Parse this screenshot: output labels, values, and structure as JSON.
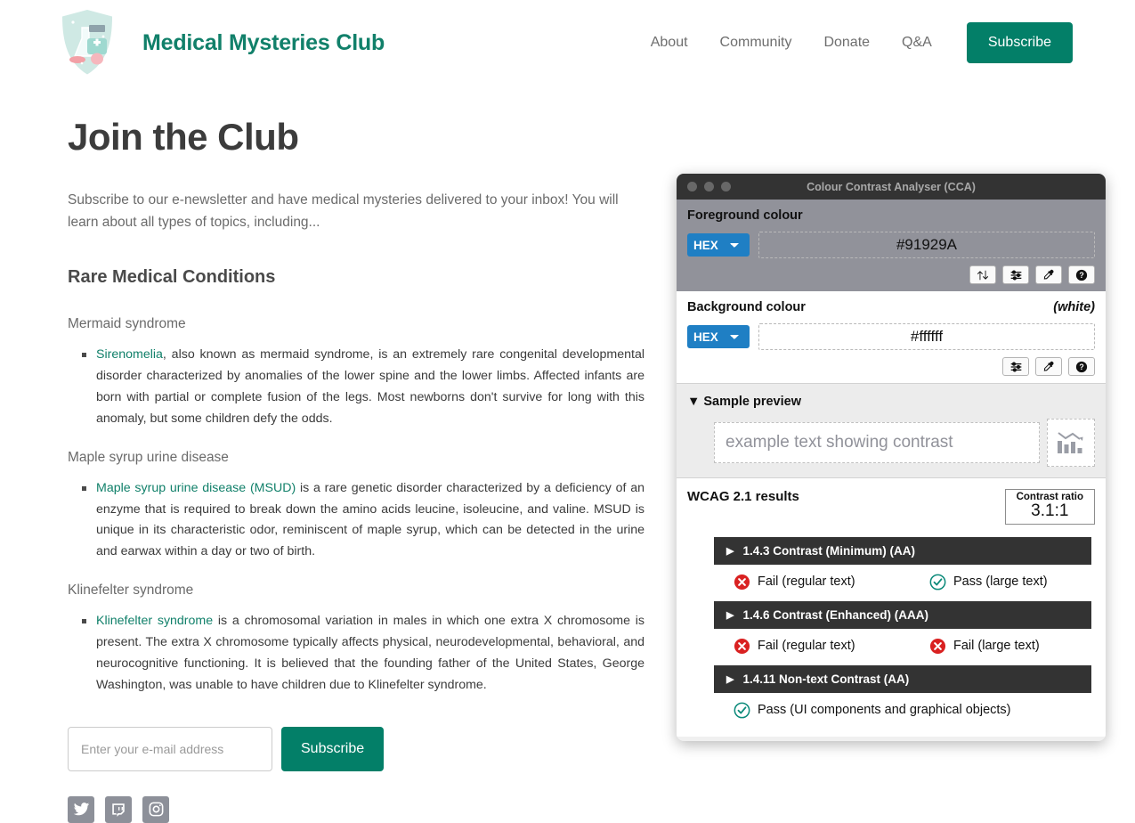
{
  "site": {
    "brand_title": "Medical Mysteries Club",
    "logo_icon": "medical-shield-logo",
    "nav": [
      {
        "label": "About",
        "name": "nav-link-about"
      },
      {
        "label": "Community",
        "name": "nav-link-community"
      },
      {
        "label": "Donate",
        "name": "nav-link-donate"
      },
      {
        "label": "Q&A",
        "name": "nav-link-qa"
      }
    ],
    "nav_subscribe_label": "Subscribe",
    "accent_color": "#037f68",
    "brand_color": "#11806a"
  },
  "main": {
    "page_title": "Join the Club",
    "intro": "Subscribe to our e-newsletter and have medical mysteries delivered to your inbox! You will learn about all types of topics, including...",
    "section_heading": "Rare Medical Conditions",
    "conditions": [
      {
        "title": "Mermaid syndrome",
        "link_text": "Sirenomelia",
        "body": ", also known as mermaid syndrome, is an extremely rare congenital developmental disorder characterized by anomalies of the lower spine and the lower limbs. Affected infants are born with partial or complete fusion of the legs. Most newborns don't survive for long with this anomaly, but some children defy the odds."
      },
      {
        "title": "Maple syrup urine disease",
        "link_text": "Maple syrup urine disease (MSUD)",
        "body": " is a rare genetic disorder characterized by a deficiency of an enzyme that is required to break down the amino acids leucine, isoleucine, and valine. MSUD is unique in its characteristic odor, reminiscent of maple syrup, which can be detected in the urine and earwax within a day or two of birth."
      },
      {
        "title": "Klinefelter syndrome",
        "link_text": "Klinefelter syndrome",
        "body": " is a chromosomal variation in males in which one extra X chromosome is present. The extra X chromosome typically affects physical, neurodevelopmental, behavioral, and neurocognitive functioning. It is believed that the founding father of the United States, George Washington, was unable to have children due to Klinefelter syndrome."
      }
    ]
  },
  "subscribe_form": {
    "email_placeholder": "Enter your e-mail address",
    "email_value": "",
    "submit_label": "Subscribe"
  },
  "social": [
    {
      "name": "twitter-icon",
      "label": "Twitter"
    },
    {
      "name": "twitch-icon",
      "label": "Twitch"
    },
    {
      "name": "instagram-icon",
      "label": "Instagram"
    }
  ],
  "cca": {
    "window_title": "Colour Contrast Analyser (CCA)",
    "foreground": {
      "label": "Foreground colour",
      "format": "HEX",
      "value": "#91929A",
      "swatch_color": "#91929a",
      "buttons": [
        "swap-colours-icon",
        "sliders-icon",
        "eyedropper-icon",
        "help-icon"
      ]
    },
    "background": {
      "label": "Background colour",
      "note": "(white)",
      "format": "HEX",
      "value": "#ffffff",
      "buttons": [
        "sliders-icon",
        "eyedropper-icon",
        "help-icon"
      ]
    },
    "preview": {
      "header": "Sample preview",
      "sample_text": "example text showing contrast",
      "chart_icon": "declining-bar-chart-icon"
    },
    "wcag": {
      "title": "WCAG 2.1 results",
      "contrast_ratio_label": "Contrast ratio",
      "contrast_ratio_value": "3.1:1",
      "groups": [
        {
          "header": "1.4.3 Contrast (Minimum) (AA)",
          "results": [
            {
              "status": "fail",
              "text": "Fail (regular text)"
            },
            {
              "status": "pass",
              "text": "Pass (large text)"
            }
          ]
        },
        {
          "header": "1.4.6 Contrast (Enhanced) (AAA)",
          "results": [
            {
              "status": "fail",
              "text": "Fail (regular text)"
            },
            {
              "status": "fail",
              "text": "Fail (large text)"
            }
          ]
        },
        {
          "header": "1.4.11 Non-text Contrast (AA)",
          "results": [
            {
              "status": "pass",
              "text": "Pass (UI components and graphical objects)"
            }
          ]
        }
      ],
      "pass_color": "#0b8a7a",
      "fail_color": "#d92121"
    }
  }
}
